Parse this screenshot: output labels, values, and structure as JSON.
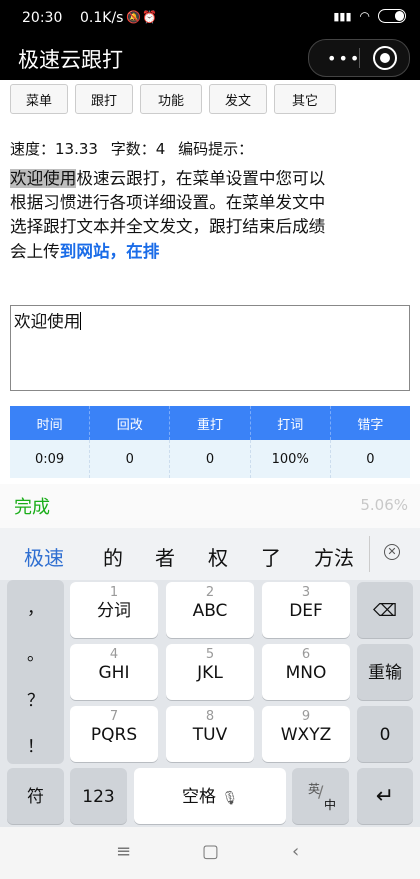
{
  "status_bar": {
    "time": "20:30",
    "network_speed": "0.1K/s"
  },
  "nav": {
    "title": "极速云跟打"
  },
  "menu": {
    "buttons": [
      "菜单",
      "跟打",
      "功能",
      "发文",
      "其它"
    ]
  },
  "stats": {
    "speed": "速度：13.33",
    "chars": "字数：4",
    "hint": "编码提示："
  },
  "passage": {
    "typed": "欢迎使用",
    "rest": "极速云跟打，在菜单设置中您可以根据习惯进行各项详细设置。在菜单发文中选择跟打文本并全文发文，跟打结束后成绩会上传",
    "link": "到网站，在排"
  },
  "input": {
    "value": "欢迎使用"
  },
  "table": {
    "headers": [
      "时间",
      "回改",
      "重打",
      "打词",
      "错字"
    ],
    "values": [
      "0:09",
      "0",
      "0",
      "100%",
      "0"
    ]
  },
  "done_bar": {
    "done_label": "完成",
    "percent": "5.06%"
  },
  "keyboard": {
    "candidates": [
      "极速",
      "的",
      "者",
      "权",
      "了",
      "方法"
    ],
    "punctuation": [
      "，",
      "。",
      "？",
      "！"
    ],
    "keys_row1": [
      {
        "num": "1",
        "label": "分词"
      },
      {
        "num": "2",
        "label": "ABC"
      },
      {
        "num": "3",
        "label": "DEF"
      }
    ],
    "keys_row2": [
      {
        "num": "4",
        "label": "GHI"
      },
      {
        "num": "5",
        "label": "JKL"
      },
      {
        "num": "6",
        "label": "MNO"
      }
    ],
    "keys_row3": [
      {
        "num": "7",
        "label": "PQRS"
      },
      {
        "num": "8",
        "label": "TUV"
      },
      {
        "num": "9",
        "label": "WXYZ"
      }
    ],
    "retype_label": "重输",
    "zero_label": "0",
    "symbol_label": "符",
    "num_label": "123",
    "space_label": "空格",
    "lang_top": "英",
    "lang_bottom": "中"
  },
  "icon_names": [
    "wifi-icon",
    "battery-icon",
    "alarm-icon",
    "mute-icon",
    "more-icon",
    "close-target-icon",
    "backspace-icon",
    "enter-icon",
    "mic-icon",
    "menu-nav-icon",
    "home-nav-icon",
    "back-nav-icon"
  ]
}
